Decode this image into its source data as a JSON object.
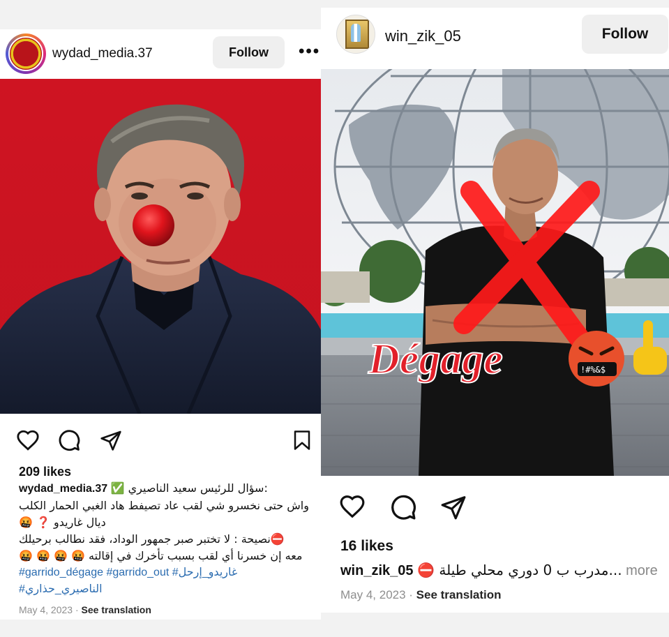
{
  "left_post": {
    "username": "wydad_media.37",
    "follow_label": "Follow",
    "more_label": "•••",
    "likes": "209 likes",
    "caption": {
      "line1_user": "wydad_media.37",
      "line1_text": "✅ سؤال للرئيس سعيد الناصيري:",
      "line2": "واش حتى نخسرو شي لقب عاد تصيفط هاد الغبي الحمار الكلب",
      "line3": "ديال غاريدو ❓ 🤬",
      "line4": "⛔نصيحة : لا تختبر صبر جمهور الوداد،  فقد نطالب برحيلك",
      "line5": "معه إن خسرنا أي لقب بسبب تأخرك في إقالته 🤬 🤬 🤬 🤬",
      "hashtags_line1": "#garrido_dégage #garrido_out #غاريدو_إرحل",
      "hashtags_line2": "#الناصيري_حذاري"
    },
    "date": "May 4, 2023",
    "separator": " · ",
    "see_translation": "See translation"
  },
  "right_post": {
    "username": "win_zik_05",
    "follow_label": "Follow",
    "likes": "16 likes",
    "caption_user": "win_zik_05",
    "caption_text": "⛔ مدرب ب 0 دوري محلي طيلة...",
    "caption_more": " more",
    "date": "May 4, 2023",
    "separator": " · ",
    "see_translation": "See translation",
    "overlay_text": "Dégage",
    "rage_face_text": "!#%&$"
  },
  "colors": {
    "left_bg": "#cf1422",
    "clown_nose": "#e0141c",
    "red_x": "#ff1a1a",
    "degage_text": "#e2202a",
    "hashtag": "#2b6cb0",
    "follow_bg": "#efefef"
  },
  "icons": [
    "heart-icon",
    "comment-icon",
    "share-icon",
    "bookmark-icon",
    "more-icon"
  ]
}
